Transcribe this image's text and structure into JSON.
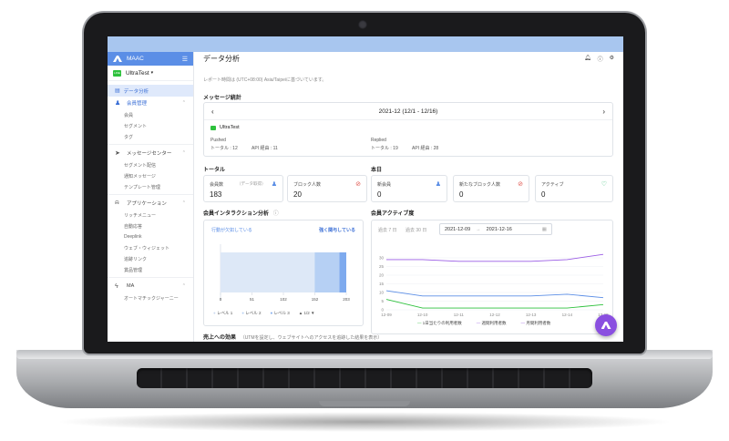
{
  "app": {
    "brand": "MAAC",
    "account": "UltraTest",
    "line_badge": "LINE"
  },
  "sidebar": {
    "data_analysis": "データ分析",
    "groups": [
      {
        "label": "会員管理",
        "items": [
          "会員",
          "セグメント",
          "タグ"
        ]
      },
      {
        "label": "メッセージセンター",
        "items": [
          "セグメント配信",
          "通知メッセージ",
          "テンプレート管理"
        ]
      },
      {
        "label": "アプリケーション",
        "items": [
          "リッチメニュー",
          "自動応答",
          "Deeplink",
          "ウェブ・ウィジェット",
          "追跡リンク",
          "賞品管理"
        ]
      },
      {
        "label": "MA",
        "items": [
          "オートマチックジャーニー"
        ]
      }
    ]
  },
  "main": {
    "title": "データ分析",
    "note": "レポート時間は (UTC+08:00) Asia/Taipeiに基づいています。",
    "message_stats": {
      "title": "メッセージ統計",
      "period": "2021-12 (12/1 - 12/16)",
      "account": "UltraTest",
      "pushed_label": "Pushed",
      "pushed_total": "トータル : 12",
      "pushed_api": "API 経由 : 11",
      "replied_label": "Replied",
      "replied_total": "トータル : 19",
      "replied_api": "API 経由 : 28"
    },
    "total": {
      "title": "トータル",
      "members_label": "会員数",
      "members_hint": "（データ取得）",
      "members_value": "183",
      "blocked_label": "ブロック人数",
      "blocked_value": "20"
    },
    "today": {
      "title": "本日",
      "new_label": "新会員",
      "new_value": "0",
      "new_blocked_label": "新たなブロック人数",
      "new_blocked_value": "0",
      "active_label": "アクティブ",
      "active_value": "0"
    },
    "interaction": {
      "title": "会員インタラクション分析",
      "left_label": "行動が欠如している",
      "right_label": "強く関与している",
      "ticks": [
        "0",
        "51",
        "102",
        "152",
        "203"
      ],
      "legend": [
        "レベル 1",
        "レベル 2",
        "レベル 3"
      ],
      "pager": "1/2",
      "levels": [
        {
          "name": "レベル 1",
          "value": 152
        },
        {
          "name": "レベル 2",
          "value": 40
        },
        {
          "name": "レベル 3",
          "value": 11
        }
      ],
      "colors": [
        "#dde8f7",
        "#b6d0f4",
        "#7eaaee"
      ]
    },
    "activity": {
      "title": "会員アクティブ度",
      "tab_7": "過去 7 日",
      "tab_30": "過去 30 日",
      "date_from": "2021-12-09",
      "date_to": "2021-12-16",
      "arrow": "→",
      "legend": [
        "1日当たりの利用者数",
        "週間利用者数",
        "月間利用者数"
      ]
    },
    "sales": {
      "title": "売上への効果",
      "hint": "（UTMを設定し、ウェブサイトへのアクセスを追跡した結果を表示）"
    }
  },
  "chart_data": {
    "type": "line",
    "x": [
      "12-09",
      "12-10",
      "12-11",
      "12-12",
      "12-13",
      "12-14",
      "12-15"
    ],
    "ylim": [
      0,
      40
    ],
    "yticks": [
      "0",
      "5",
      "10",
      "15",
      "20",
      "25",
      "30"
    ],
    "series": [
      {
        "name": "1日当たりの利用者数",
        "color": "#2ec13d",
        "values": [
          6,
          1,
          1,
          1,
          1,
          1,
          3
        ]
      },
      {
        "name": "週間利用者数",
        "color": "#5b8ee6",
        "values": [
          11,
          8,
          8,
          8,
          8,
          9,
          7
        ]
      },
      {
        "name": "月間利用者数",
        "color": "#9b5de5",
        "values": [
          29,
          29,
          28,
          28,
          28,
          29,
          32
        ]
      }
    ]
  }
}
